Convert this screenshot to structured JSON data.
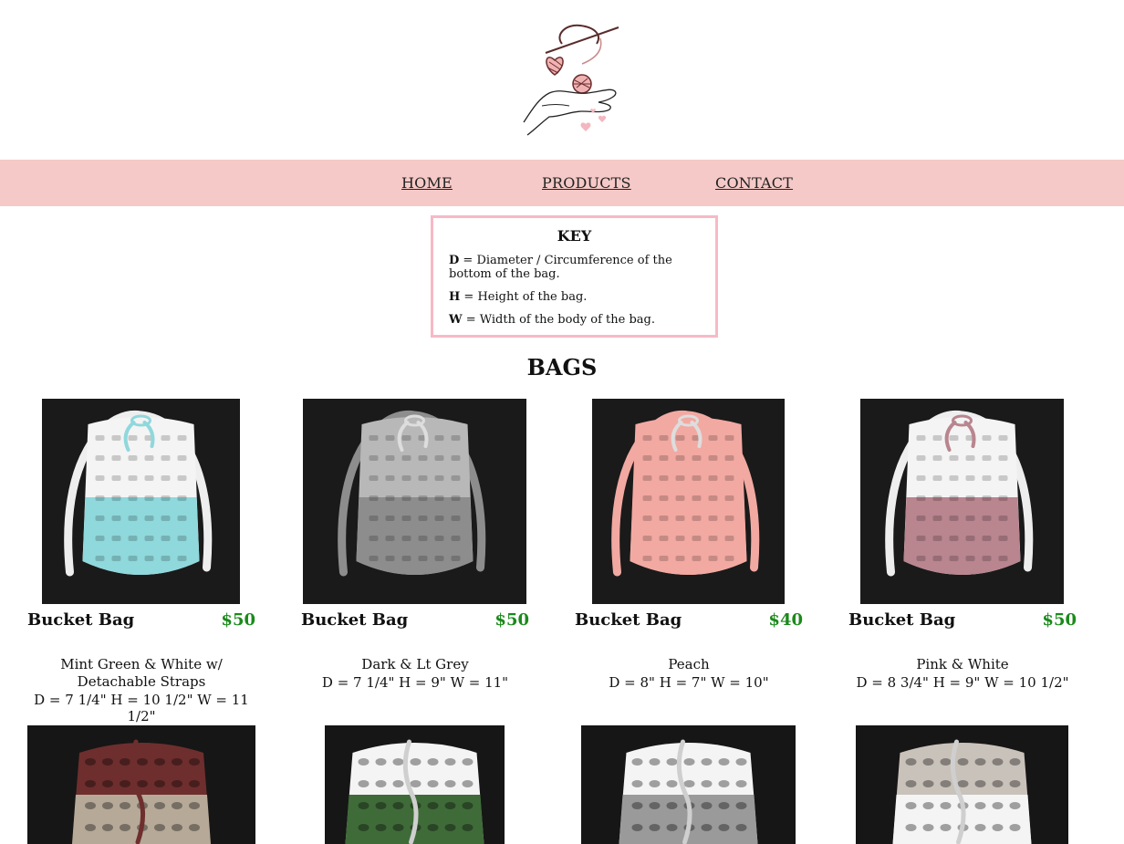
{
  "nav": {
    "home": "HOME",
    "products": "PRODUCTS",
    "contact": "CONTACT"
  },
  "key": {
    "title": "KEY",
    "lines": [
      {
        "letter": "D",
        "text": " = Diameter / Circumference of the bottom of the bag."
      },
      {
        "letter": "H",
        "text": " = Height of the bag."
      },
      {
        "letter": "W",
        "text": " = Width of the body of the bag."
      }
    ]
  },
  "section_title": "BAGS",
  "products": [
    {
      "name": "Bucket Bag",
      "price": "$50",
      "desc": "Mint Green & White w/ Detachable Straps",
      "dims": "D = 7 1/4\" H = 10 1/2\" W = 11 1/2\"",
      "colors": [
        "#8fd8dc",
        "#f4f4f4"
      ]
    },
    {
      "name": "Bucket Bag",
      "price": "$50",
      "desc": "Dark & Lt Grey",
      "dims": "D = 7 1/4\" H = 9\" W = 11\"",
      "colors": [
        "#8d8d8d",
        "#b8b8b8"
      ]
    },
    {
      "name": "Bucket Bag",
      "price": "$40",
      "desc": "Peach",
      "dims": "D = 8\" H = 7\" W = 10\"",
      "colors": [
        "#f2a9a2",
        "#f2a9a2"
      ]
    },
    {
      "name": "Bucket Bag",
      "price": "$50",
      "desc": "Pink & White",
      "dims": "D = 8 3/4\" H = 9\" W = 10 1/2\"",
      "colors": [
        "#b9858f",
        "#f4f4f4"
      ]
    }
  ],
  "row2_colors": [
    [
      "#b6a998",
      "#6e2e2e"
    ],
    [
      "#3f6b39",
      "#f4f4f4"
    ],
    [
      "#9a9a9a",
      "#f4f4f4"
    ],
    [
      "#f4f4f4",
      "#c9c2ba"
    ]
  ]
}
